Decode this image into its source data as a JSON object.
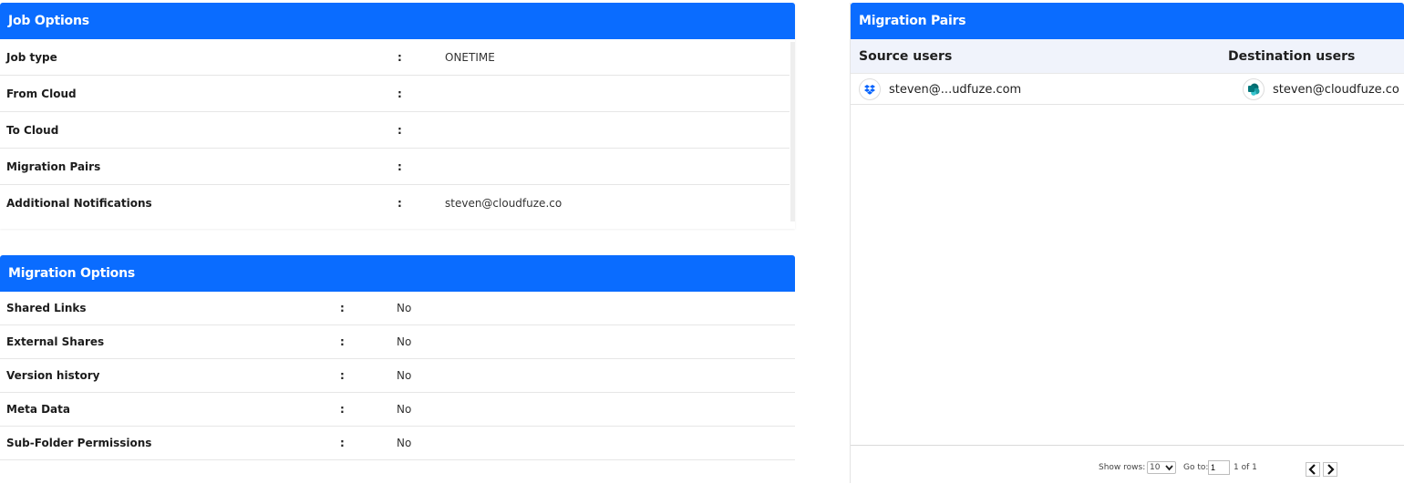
{
  "job_options": {
    "title": "Job Options",
    "rows": [
      {
        "label": "Job type",
        "colon": ":",
        "value": "ONETIME"
      },
      {
        "label": "From Cloud",
        "colon": ":",
        "value": ""
      },
      {
        "label": "To Cloud",
        "colon": ":",
        "value": ""
      },
      {
        "label": "Migration Pairs",
        "colon": ":",
        "value": ""
      },
      {
        "label": "Additional Notifications",
        "colon": ":",
        "value": "steven@cloudfuze.co"
      }
    ]
  },
  "migration_options": {
    "title": "Migration Options",
    "rows": [
      {
        "label": "Shared Links",
        "colon": ":",
        "value": "No"
      },
      {
        "label": "External Shares",
        "colon": ":",
        "value": "No"
      },
      {
        "label": "Version history",
        "colon": ":",
        "value": "No"
      },
      {
        "label": "Meta Data",
        "colon": ":",
        "value": "No"
      },
      {
        "label": "Sub-Folder Permissions",
        "colon": ":",
        "value": "No"
      }
    ]
  },
  "migration_pairs": {
    "title": "Migration Pairs",
    "col_source": "Source users",
    "col_destination": "Destination users",
    "pairs": [
      {
        "source": "steven@...udfuze.com",
        "source_icon": "dropbox-icon",
        "destination": "steven@cloudfuze.co",
        "destination_icon": "sharepoint-icon"
      }
    ],
    "footer": {
      "show_rows_label": "Show rows:",
      "rows_value": "10",
      "goto_label": "Go to:",
      "goto_value": "1",
      "page_info": "1 of 1"
    }
  },
  "colors": {
    "header_blue": "#0a6cff",
    "dropbox_blue": "#0061fe",
    "sharepoint_teal": "#038387"
  }
}
